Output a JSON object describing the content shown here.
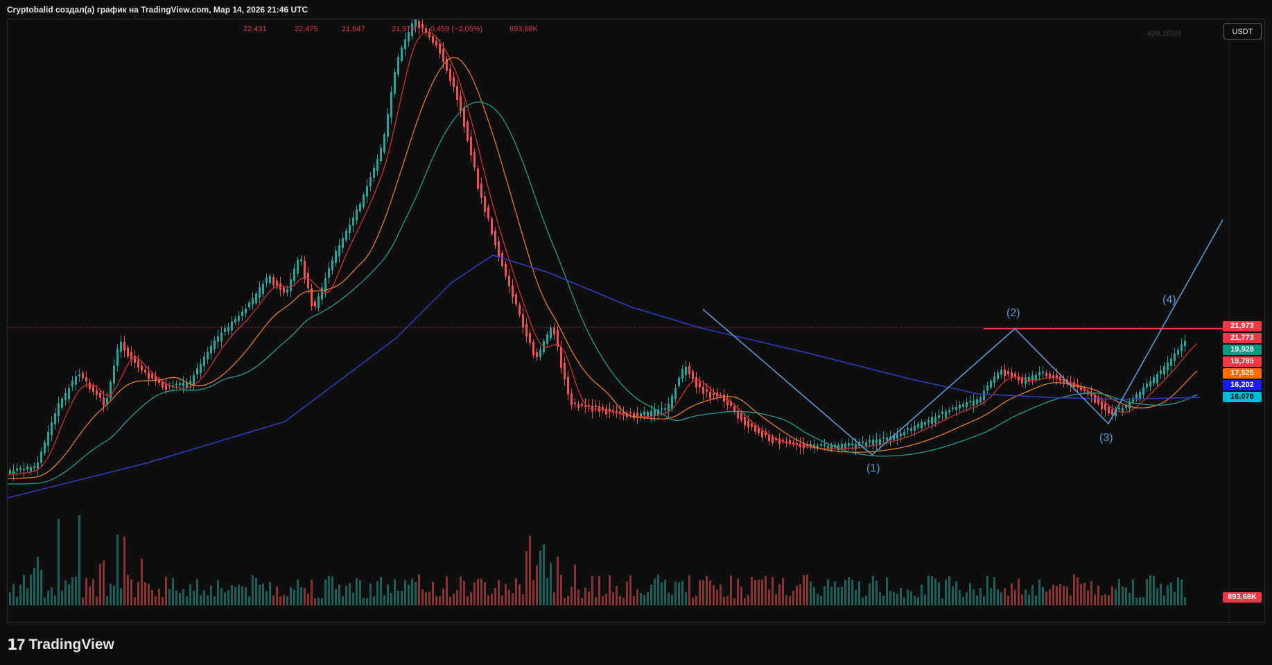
{
  "header": {
    "title": "Cryptobalid создал(а) график на TradingView.com, Мар 14, 2026 21:46 UTC"
  },
  "ohlc": {
    "open": "22,431",
    "high": "22,475",
    "low": "21,647",
    "close": "21,973",
    "change": "-0,459 (−2,05%)",
    "volume": "893,68K"
  },
  "scale": {
    "currency_button": "USDT",
    "volume_max": "409,105M"
  },
  "price_tags": [
    {
      "value": "21,973",
      "color": "#f23645"
    },
    {
      "value": "21,773",
      "color": "#f23645"
    },
    {
      "value": "19,928",
      "color": "#089981"
    },
    {
      "value": "19,785",
      "color": "#f23645"
    },
    {
      "value": "17,525",
      "color": "#ff6d00"
    },
    {
      "value": "16,202",
      "color": "#1a1aff"
    },
    {
      "value": "16,076",
      "color": "#00bcd4"
    }
  ],
  "volume_tag": {
    "value": "893,68K",
    "color": "#f23645"
  },
  "wave_labels": [
    "(1)",
    "(2)",
    "(3)",
    "(4)"
  ],
  "footer": {
    "brand": "TradingView",
    "brand_icon": "tradingview-logo-icon"
  },
  "colors": {
    "up": "#26a69a",
    "down": "#ef5350",
    "pattern": "#5b9bd5",
    "resistance": "#f23645"
  }
}
